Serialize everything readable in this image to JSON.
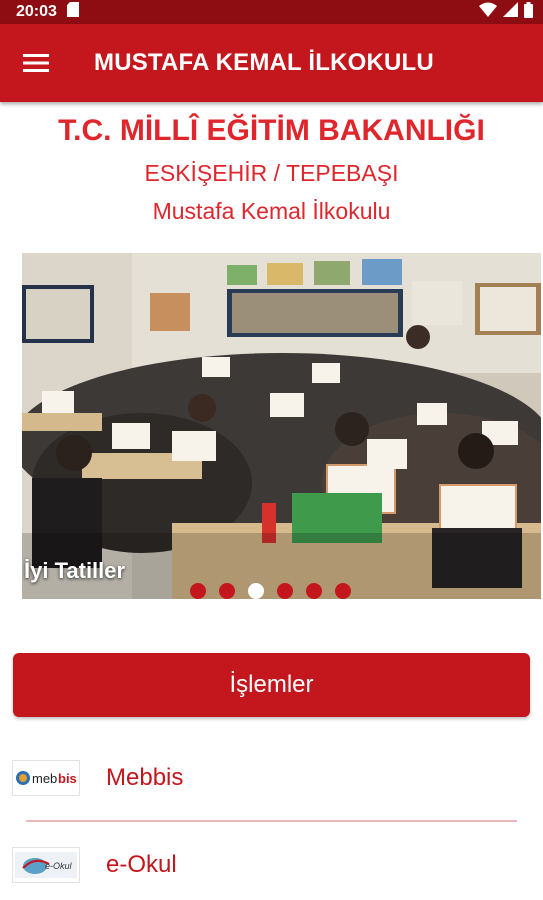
{
  "status_bar": {
    "time": "20:03"
  },
  "app_bar": {
    "title": "MUSTAFA KEMAL İLKOKULU"
  },
  "header": {
    "ministry": "T.C. MİLLÎ EĞİTİM BAKANLIĞI",
    "region": "ESKİŞEHİR / TEPEBAŞI",
    "school": "Mustafa Kemal İlkokulu"
  },
  "carousel": {
    "caption": "İyi Tatiller",
    "slide_count": 6,
    "active_index": 2
  },
  "actions": {
    "operations_label": "İşlemler",
    "links": [
      {
        "label": "Mebbis",
        "icon": "mebbis-logo"
      },
      {
        "label": "e-Okul",
        "icon": "eokul-logo"
      }
    ]
  },
  "colors": {
    "primary": "#c4161d",
    "status_bar": "#8e0d12",
    "header_text": "#e0262d"
  }
}
